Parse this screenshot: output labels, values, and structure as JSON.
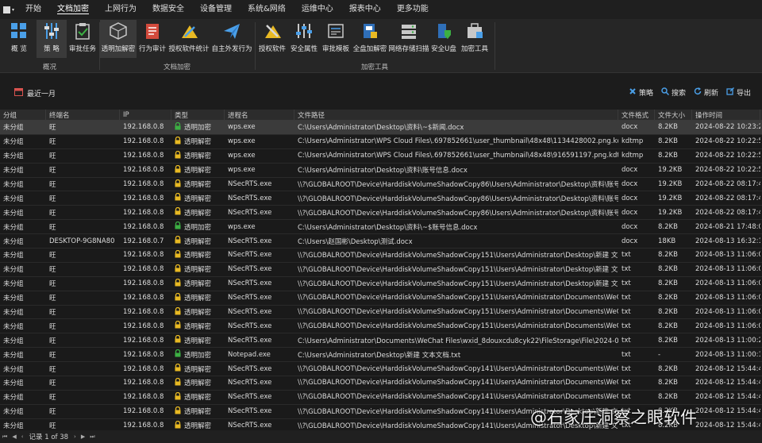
{
  "menubar": {
    "items": [
      "开始",
      "文档加密",
      "上网行为",
      "数据安全",
      "设备管理",
      "系统&网络",
      "运维中心",
      "报表中心",
      "更多功能"
    ],
    "active_index": 1
  },
  "ribbon": {
    "groups": [
      {
        "label": "概况",
        "buttons": [
          "概 览",
          "策 略",
          "审批任务"
        ]
      },
      {
        "label": "文档加密",
        "buttons": [
          "透明加解密",
          "行为审计",
          "授权软件统计",
          "自主外发行为"
        ]
      },
      {
        "label": "加密工具",
        "buttons": [
          "授权软件",
          "安全属性",
          "审批模板",
          "全盘加解密",
          "网络存储扫描",
          "安全U盘",
          "加密工具"
        ]
      }
    ]
  },
  "toolbar": {
    "range_label": "最近一月",
    "right_buttons": [
      "策略",
      "搜索",
      "刷新",
      "导出"
    ]
  },
  "table": {
    "columns": [
      "分组",
      "终端名",
      "IP",
      "类型",
      "进程名",
      "文件路径",
      "文件格式",
      "文件大小",
      "操作时间"
    ],
    "rows": [
      [
        "未分组",
        "旺",
        "192.168.0.8",
        "透明加密",
        "wps.exe",
        "C:\\Users\\Administrator\\Desktop\\资料\\~$新闻.docx",
        "docx",
        "8.2KB",
        "2024-08-22 10:23:21"
      ],
      [
        "未分组",
        "旺",
        "192.168.0.8",
        "透明解密",
        "wps.exe",
        "C:\\Users\\Administrator\\WPS Cloud Files\\.697852661\\user_thumbnail\\48x48\\1134428002.png.kdtmp",
        "kdtmp",
        "8.2KB",
        "2024-08-22 10:22:59"
      ],
      [
        "未分组",
        "旺",
        "192.168.0.8",
        "透明解密",
        "wps.exe",
        "C:\\Users\\Administrator\\WPS Cloud Files\\.697852661\\user_thumbnail\\48x48\\916591197.png.kdtmp",
        "kdtmp",
        "8.2KB",
        "2024-08-22 10:22:59"
      ],
      [
        "未分组",
        "旺",
        "192.168.0.8",
        "透明解密",
        "wps.exe",
        "C:\\Users\\Administrator\\Desktop\\资料\\账号信息.docx",
        "docx",
        "19.2KB",
        "2024-08-22 10:22:58"
      ],
      [
        "未分组",
        "旺",
        "192.168.0.8",
        "透明解密",
        "NSecRTS.exe",
        "\\\\?\\GLOBALROOT\\Device\\HarddiskVolumeShadowCopy86\\Users\\Administrator\\Desktop\\资料\\账号信息...",
        "docx",
        "19.2KB",
        "2024-08-22 08:17:49"
      ],
      [
        "未分组",
        "旺",
        "192.168.0.8",
        "透明解密",
        "NSecRTS.exe",
        "\\\\?\\GLOBALROOT\\Device\\HarddiskVolumeShadowCopy86\\Users\\Administrator\\Desktop\\资料\\账号信息...",
        "docx",
        "19.2KB",
        "2024-08-22 08:17:49"
      ],
      [
        "未分组",
        "旺",
        "192.168.0.8",
        "透明解密",
        "NSecRTS.exe",
        "\\\\?\\GLOBALROOT\\Device\\HarddiskVolumeShadowCopy86\\Users\\Administrator\\Desktop\\资料\\账号信息...",
        "docx",
        "19.2KB",
        "2024-08-22 08:17:49"
      ],
      [
        "未分组",
        "旺",
        "192.168.0.8",
        "透明加密",
        "wps.exe",
        "C:\\Users\\Administrator\\Desktop\\资料\\~$账号信息.docx",
        "docx",
        "8.2KB",
        "2024-08-21 17:48:08"
      ],
      [
        "未分组",
        "DESKTOP-9G8NA80",
        "192.168.0.7",
        "透明解密",
        "NSecRTS.exe",
        "C:\\Users\\赵国彬\\Desktop\\测试.docx",
        "docx",
        "18KB",
        "2024-08-13 16:32:13"
      ],
      [
        "未分组",
        "旺",
        "192.168.0.8",
        "透明解密",
        "NSecRTS.exe",
        "\\\\?\\GLOBALROOT\\Device\\HarddiskVolumeShadowCopy151\\Users\\Administrator\\Desktop\\新建 文本文...",
        "txt",
        "8.2KB",
        "2024-08-13 11:06:07"
      ],
      [
        "未分组",
        "旺",
        "192.168.0.8",
        "透明解密",
        "NSecRTS.exe",
        "\\\\?\\GLOBALROOT\\Device\\HarddiskVolumeShadowCopy151\\Users\\Administrator\\Desktop\\新建 文本文...",
        "txt",
        "8.2KB",
        "2024-08-13 11:06:07"
      ],
      [
        "未分组",
        "旺",
        "192.168.0.8",
        "透明解密",
        "NSecRTS.exe",
        "\\\\?\\GLOBALROOT\\Device\\HarddiskVolumeShadowCopy151\\Users\\Administrator\\Desktop\\新建 文本文...",
        "txt",
        "8.2KB",
        "2024-08-13 11:06:07"
      ],
      [
        "未分组",
        "旺",
        "192.168.0.8",
        "透明解密",
        "NSecRTS.exe",
        "\\\\?\\GLOBALROOT\\Device\\HarddiskVolumeShadowCopy151\\Users\\Administrator\\Documents\\WeChat Fi...",
        "txt",
        "8.2KB",
        "2024-08-13 11:06:07"
      ],
      [
        "未分组",
        "旺",
        "192.168.0.8",
        "透明解密",
        "NSecRTS.exe",
        "\\\\?\\GLOBALROOT\\Device\\HarddiskVolumeShadowCopy151\\Users\\Administrator\\Documents\\WeChat Fi...",
        "txt",
        "8.2KB",
        "2024-08-13 11:06:07"
      ],
      [
        "未分组",
        "旺",
        "192.168.0.8",
        "透明解密",
        "NSecRTS.exe",
        "\\\\?\\GLOBALROOT\\Device\\HarddiskVolumeShadowCopy151\\Users\\Administrator\\Documents\\WeChat Fi...",
        "txt",
        "8.2KB",
        "2024-08-13 11:06:07"
      ],
      [
        "未分组",
        "旺",
        "192.168.0.8",
        "透明解密",
        "NSecRTS.exe",
        "C:\\Users\\Administrator\\Documents\\WeChat Files\\wxid_8douxcdu8cyk22\\FileStorage\\File\\2024-08\\新建 ...",
        "txt",
        "8.2KB",
        "2024-08-13 11:00:25"
      ],
      [
        "未分组",
        "旺",
        "192.168.0.8",
        "透明加密",
        "Notepad.exe",
        "C:\\Users\\Administrator\\Desktop\\新建 文本文档.txt",
        "txt",
        "-",
        "2024-08-13 11:00:15"
      ],
      [
        "未分组",
        "旺",
        "192.168.0.8",
        "透明解密",
        "NSecRTS.exe",
        "\\\\?\\GLOBALROOT\\Device\\HarddiskVolumeShadowCopy141\\Users\\Administrator\\Documents\\WeChat Fi...",
        "txt",
        "8.2KB",
        "2024-08-12 15:44:41"
      ],
      [
        "未分组",
        "旺",
        "192.168.0.8",
        "透明解密",
        "NSecRTS.exe",
        "\\\\?\\GLOBALROOT\\Device\\HarddiskVolumeShadowCopy141\\Users\\Administrator\\Documents\\WeChat Fi...",
        "txt",
        "8.2KB",
        "2024-08-12 15:44:41"
      ],
      [
        "未分组",
        "旺",
        "192.168.0.8",
        "透明解密",
        "NSecRTS.exe",
        "\\\\?\\GLOBALROOT\\Device\\HarddiskVolumeShadowCopy141\\Users\\Administrator\\Documents\\WeChat Fi...",
        "txt",
        "8.2KB",
        "2024-08-12 15:44:41"
      ],
      [
        "未分组",
        "旺",
        "192.168.0.8",
        "透明解密",
        "NSecRTS.exe",
        "\\\\?\\GLOBALROOT\\Device\\HarddiskVolumeShadowCopy141\\Users\\Administrator\\Desktop\\新建 文本文...",
        "txt",
        "8.2KB",
        "2024-08-12 15:44:41"
      ],
      [
        "未分组",
        "旺",
        "192.168.0.8",
        "透明解密",
        "NSecRTS.exe",
        "\\\\?\\GLOBALROOT\\Device\\HarddiskVolumeShadowCopy141\\Users\\Administrator\\Desktop\\新建 文本文...",
        "txt",
        "8.2KB",
        "2024-08-12 15:44:41"
      ]
    ],
    "selected_row": 0
  },
  "status": {
    "record_text": "记录 1 of 38"
  },
  "watermark": {
    "text": "@石家庄洞察之眼软件"
  },
  "colors": {
    "encrypt_lock": "#3cb043",
    "decrypt_lock": "#e8b923",
    "accent_blue": "#3c8dde"
  }
}
